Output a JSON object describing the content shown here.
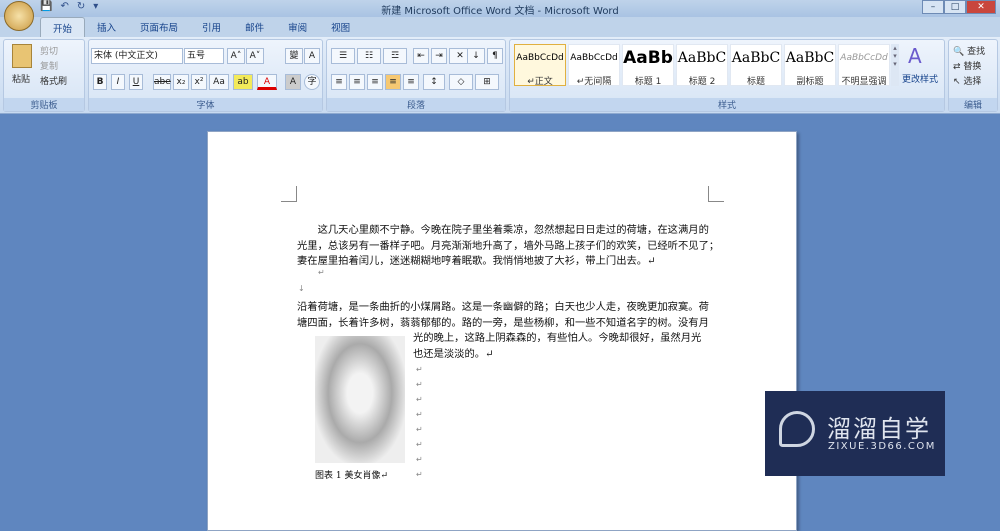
{
  "window": {
    "title": "新建 Microsoft Office Word 文档 - Microsoft Word"
  },
  "tabs": [
    "开始",
    "插入",
    "页面布局",
    "引用",
    "邮件",
    "审阅",
    "视图"
  ],
  "clipboard": {
    "paste": "粘贴",
    "cut": "剪切",
    "copy": "复制",
    "format_painter": "格式刷",
    "label": "剪贴板"
  },
  "font": {
    "name": "宋体 (中文正文)",
    "size": "五号",
    "label": "字体",
    "bold": "B",
    "italic": "I",
    "underline": "U",
    "strike": "abe",
    "sub": "x₂",
    "sup": "x²",
    "case": "Aa",
    "grow": "A˄",
    "shrink": "A˅",
    "char_shade": "A",
    "enclose": "字"
  },
  "paragraph": {
    "label": "段落"
  },
  "styles": {
    "label": "样式",
    "change": "更改样式",
    "items": [
      {
        "sample": "AaBbCcDd",
        "name": "↵正文"
      },
      {
        "sample": "AaBbCcDd",
        "name": "↵无间隔"
      },
      {
        "sample": "AaBb",
        "name": "标题 1"
      },
      {
        "sample": "AaBbC",
        "name": "标题 2"
      },
      {
        "sample": "AaBbC",
        "name": "标题"
      },
      {
        "sample": "AaBbC",
        "name": "副标题"
      },
      {
        "sample": "AaBbCcDd",
        "name": "不明显强调"
      }
    ]
  },
  "editing": {
    "label": "编辑",
    "find": "查找",
    "replace": "替换",
    "select": "选择"
  },
  "document": {
    "lines": [
      "　　这几天心里颇不宁静。今晚在院子里坐着乘凉，忽然想起日日走过的荷塘，在这满月的",
      "光里，总该另有一番样子吧。月亮渐渐地升高了，墙外马路上孩子们的欢笑，已经听不见了；",
      "妻在屋里拍着闰儿，迷迷糊糊地哼着眠歌。我悄悄地披了大衫，带上门出去。↵",
      "沿着荷塘，是一条曲折的小煤屑路。这是一条幽僻的路；白天也少人走，夜晚更加寂寞。荷",
      "塘四面，长着许多树，蓊蓊郁郁的。路的一旁，是些杨柳，和一些不知道名字的树。没有月"
    ],
    "wrapped_lines": [
      "光的晚上，这路上阴森森的，有些怕人。今晚却很好，虽然月光",
      "也还是淡淡的。↵"
    ],
    "caption": "图表 1 美女肖像↵"
  },
  "watermark": {
    "name": "溜溜自学",
    "url": "ZIXUE.3D66.COM"
  }
}
